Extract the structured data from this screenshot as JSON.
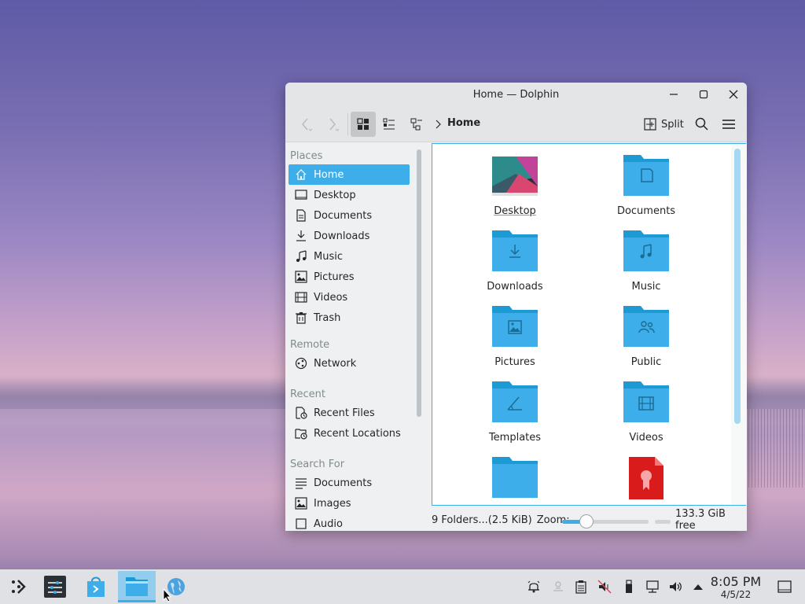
{
  "window": {
    "title": "Home — Dolphin"
  },
  "toolbar": {
    "breadcrumb": "Home",
    "split_label": "Split"
  },
  "sidebar": {
    "sections": [
      {
        "title": "Places"
      },
      {
        "title": "Remote"
      },
      {
        "title": "Recent"
      },
      {
        "title": "Search For"
      }
    ],
    "places": [
      {
        "label": "Home",
        "icon": "home-icon"
      },
      {
        "label": "Desktop",
        "icon": "desktop-icon"
      },
      {
        "label": "Documents",
        "icon": "documents-icon"
      },
      {
        "label": "Downloads",
        "icon": "downloads-icon"
      },
      {
        "label": "Music",
        "icon": "music-icon"
      },
      {
        "label": "Pictures",
        "icon": "pictures-icon"
      },
      {
        "label": "Videos",
        "icon": "videos-icon"
      },
      {
        "label": "Trash",
        "icon": "trash-icon"
      }
    ],
    "remote": [
      {
        "label": "Network",
        "icon": "network-icon"
      }
    ],
    "recent": [
      {
        "label": "Recent Files",
        "icon": "recent-files-icon"
      },
      {
        "label": "Recent Locations",
        "icon": "recent-locations-icon"
      }
    ],
    "search": [
      {
        "label": "Documents",
        "icon": "search-documents-icon"
      },
      {
        "label": "Images",
        "icon": "search-images-icon"
      },
      {
        "label": "Audio",
        "icon": "search-audio-icon"
      }
    ]
  },
  "files": [
    {
      "label": "Desktop",
      "icon": "desktop-folder-icon"
    },
    {
      "label": "Documents",
      "icon": "documents-folder-icon"
    },
    {
      "label": "Downloads",
      "icon": "downloads-folder-icon"
    },
    {
      "label": "Music",
      "icon": "music-folder-icon"
    },
    {
      "label": "Pictures",
      "icon": "pictures-folder-icon"
    },
    {
      "label": "Public",
      "icon": "public-folder-icon"
    },
    {
      "label": "Templates",
      "icon": "templates-folder-icon"
    },
    {
      "label": "Videos",
      "icon": "videos-folder-icon"
    },
    {
      "label": "",
      "icon": "folder-icon"
    },
    {
      "label": "",
      "icon": "certificate-file-icon"
    }
  ],
  "status": {
    "summary": "9 Folders...(2.5 KiB)",
    "zoom_label": "Zoom:",
    "zoom_level": 0.28,
    "free_space": "133.3 GiB free"
  },
  "taskbar": {
    "time": "8:05 PM",
    "date": "4/5/22"
  },
  "colors": {
    "accent": "#3daee9",
    "folder": "#3daee9",
    "folder_dark": "#1d99d3"
  }
}
